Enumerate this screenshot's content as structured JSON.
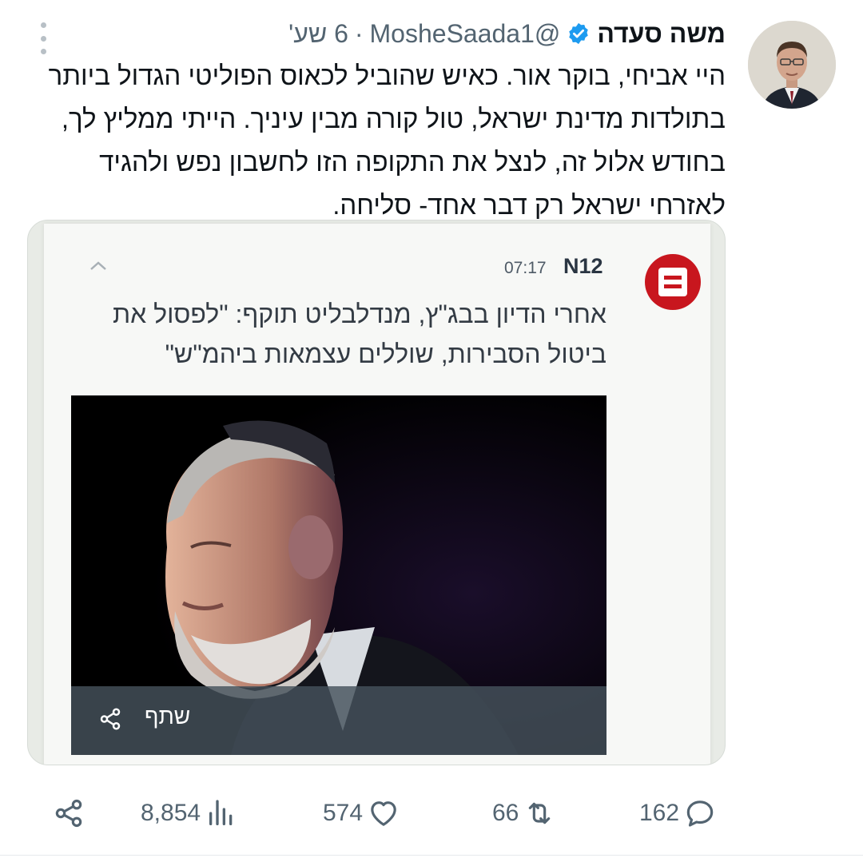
{
  "author": {
    "name": "משה סעדה",
    "handle": "@MosheSaada1",
    "separator": "·",
    "time": "6 שע'"
  },
  "tweet": {
    "lines": [
      "היי אביחי, בוקר אור. כאיש שהוביל לכאוס הפוליטי הגדול ביותר",
      "בתולדות מדינת ישראל, טול קורה מבין עיניך.  הייתי ממליץ לך,",
      "בחודש אלול זה, לנצל את התקופה הזו לחשבון נפש ולהגיד",
      "לאזרחי ישראל רק דבר אחד- סליחה."
    ]
  },
  "card": {
    "source": "N12",
    "time": "07:17",
    "headline_lines": [
      "אחרי הדיון בבג\"ץ, מנדלבליט תוקף: \"לפסול את",
      "ביטול הסבירות, שוללים עצמאות ביהמ\"ש\""
    ],
    "share_label": "שתף"
  },
  "actions": {
    "replies": "162",
    "retweets": "66",
    "likes": "574",
    "views": "8,854"
  },
  "colors": {
    "accent": "#1d9bf0",
    "muted": "#536471",
    "source_red": "#c8161e"
  },
  "icons": [
    "verified-badge-icon",
    "more-icon",
    "collapse-up-icon",
    "share-icon",
    "reply-icon",
    "retweet-icon",
    "like-icon",
    "views-icon",
    "share-tweet-icon"
  ]
}
